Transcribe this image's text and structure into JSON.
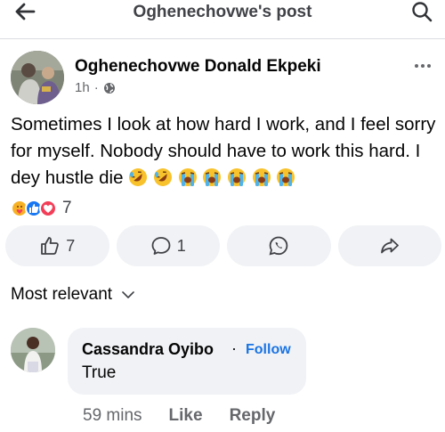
{
  "header": {
    "title": "Oghenechovwe's post",
    "back_icon": "back-arrow-icon",
    "search_icon": "search-icon"
  },
  "post": {
    "author": "Oghenechovwe Donald Ekpeki",
    "time": "1h",
    "separator": "·",
    "privacy_icon": "globe-icon",
    "text": "Sometimes I look at how hard I work, and I feel sorry for myself. Nobody should have to work this hard. I dey hustle die",
    "emojis": [
      "rofl",
      "rofl",
      "loudly-crying",
      "loudly-crying",
      "loudly-crying",
      "loudly-crying",
      "loudly-crying"
    ],
    "reaction_icons": [
      "care-icon",
      "like-icon",
      "love-icon"
    ],
    "reaction_count": "7"
  },
  "actions": {
    "like_count": "7",
    "comment_count": "1",
    "share_whatsapp_icon": "whatsapp-icon",
    "share_icon": "share-arrow-icon"
  },
  "comments": {
    "sort_label": "Most relevant",
    "items": [
      {
        "author": "Cassandra Oyibo",
        "dot": "·",
        "follow_label": "Follow",
        "text": "True",
        "time": "59 mins",
        "like_label": "Like",
        "reply_label": "Reply"
      }
    ]
  },
  "colors": {
    "link_blue": "#1b74e4",
    "like_blue": "#1877f2",
    "love_red": "#f33e58",
    "care_yellow": "#f7b125",
    "button_bg": "#f0f2f5"
  }
}
